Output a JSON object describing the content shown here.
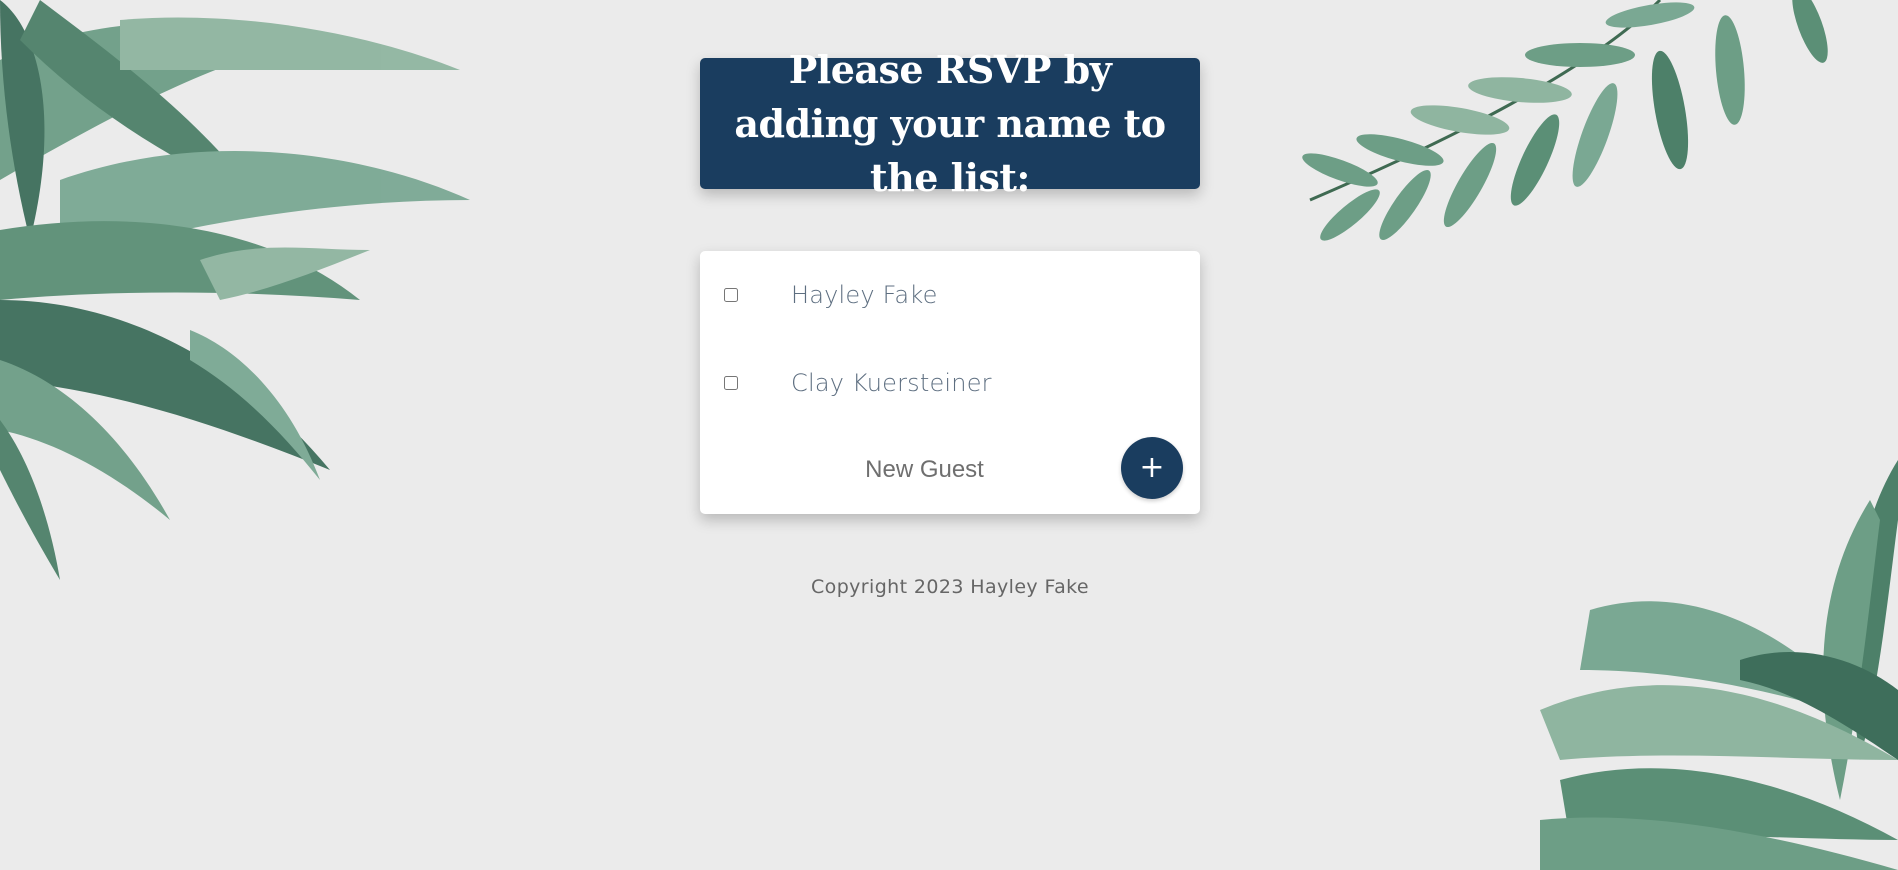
{
  "heading": {
    "title": "Please RSVP by adding your name to the list:"
  },
  "guest_list": {
    "guests": [
      {
        "name": "Hayley Fake",
        "checked": false
      },
      {
        "name": "Clay Kuersteiner",
        "checked": false
      }
    ],
    "new_guest_placeholder": "New Guest",
    "add_button_label": "+"
  },
  "footer": {
    "copyright": "Copyright 2023 Hayley Fake"
  },
  "colors": {
    "background": "#ebebeb",
    "accent": "#1a3d5f",
    "card": "#ffffff",
    "guest_text": "#5d6e80",
    "leaf_dark": "#3e6e5b",
    "leaf_mid": "#5b8f76",
    "leaf_light": "#8fb5a0"
  },
  "icons": {
    "leaves_top_left": "tropical-leaves-icon",
    "leaves_top_right": "fern-branch-icon",
    "leaves_bottom_right": "tropical-leaves-icon"
  }
}
